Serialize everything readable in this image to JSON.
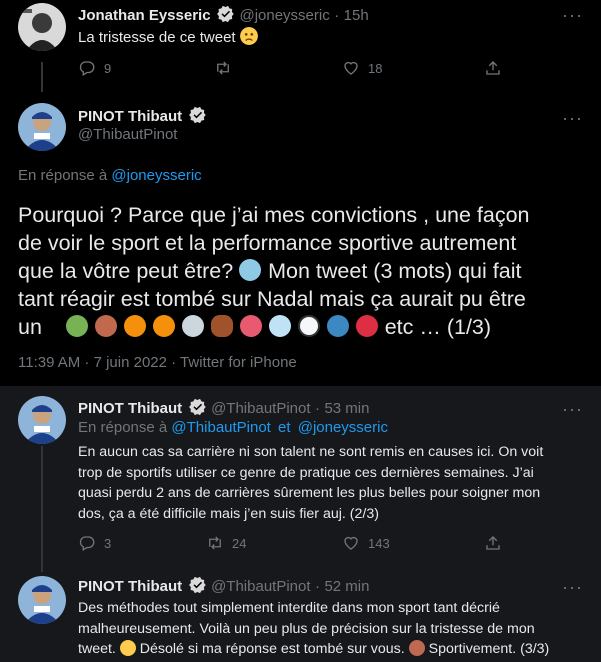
{
  "tweet1": {
    "name": "Jonathan Eysseric",
    "handle": "@joneysseric",
    "sep": "·",
    "time": "15h",
    "text": "La tristesse de ce tweet",
    "replies": "9",
    "likes": "18"
  },
  "main": {
    "name": "PINOT Thibaut",
    "handle": "@ThibautPinot",
    "reply_prefix": "En réponse à",
    "reply_to": "@joneysseric",
    "line1": "Pourquoi ? Parce que j’ai mes convictions , une façon",
    "line2": "de voir le sport et la performance sportive autrement",
    "line3a": "que la vôtre peut être?",
    "line3b": "Mon tweet (3 mots) qui fait",
    "line4": "tant réagir est tombé sur Nadal mais  ça aurait pu être",
    "line5a": "un",
    "line5b": "etc … (1/3)",
    "meta": "11:39 AM · 7 juin 2022 · Twitter for iPhone",
    "colors": {
      "accent": "#1d9bf0",
      "text": "#e7e9ea",
      "muted": "#71767b"
    }
  },
  "reply2": {
    "name": "PINOT Thibaut",
    "handle": "@ThibautPinot",
    "sep": "·",
    "time": "53 min",
    "reply_prefix": "En réponse à",
    "reply_to_1": "@ThibautPinot",
    "reply_and": "et",
    "reply_to_2": "@joneysseric",
    "line1": "En aucun cas sa carrière ni son talent ne sont remis en causes ici. On voit",
    "line2": "trop de sportifs utiliser ce genre de pratique ces dernières semaines. J’ai",
    "line3": "quasi perdu 2 ans de carrières sûrement les plus belles pour soigner mon",
    "line4": "dos, ça a été difficile mais j’en suis fier auj. (2/3)",
    "replies": "3",
    "retweets": "24",
    "likes": "143"
  },
  "reply3": {
    "name": "PINOT Thibaut",
    "handle": "@ThibautPinot",
    "sep": "·",
    "time": "52 min",
    "line1": "Des méthodes tout simplement interdite dans mon sport tant décrié",
    "line2": "malheureusement. Voilà un peu plus de précision sur la tristesse de mon",
    "line3a": "tweet.",
    "line3b": "Désolé si ma réponse est tombé sur vous.",
    "line3c": "Sportivement. (3/3)"
  },
  "icons": [
    "reply-icon",
    "retweet-icon",
    "like-icon",
    "share-icon",
    "verified-icon",
    "more-icon",
    "sad-face-emoji"
  ]
}
